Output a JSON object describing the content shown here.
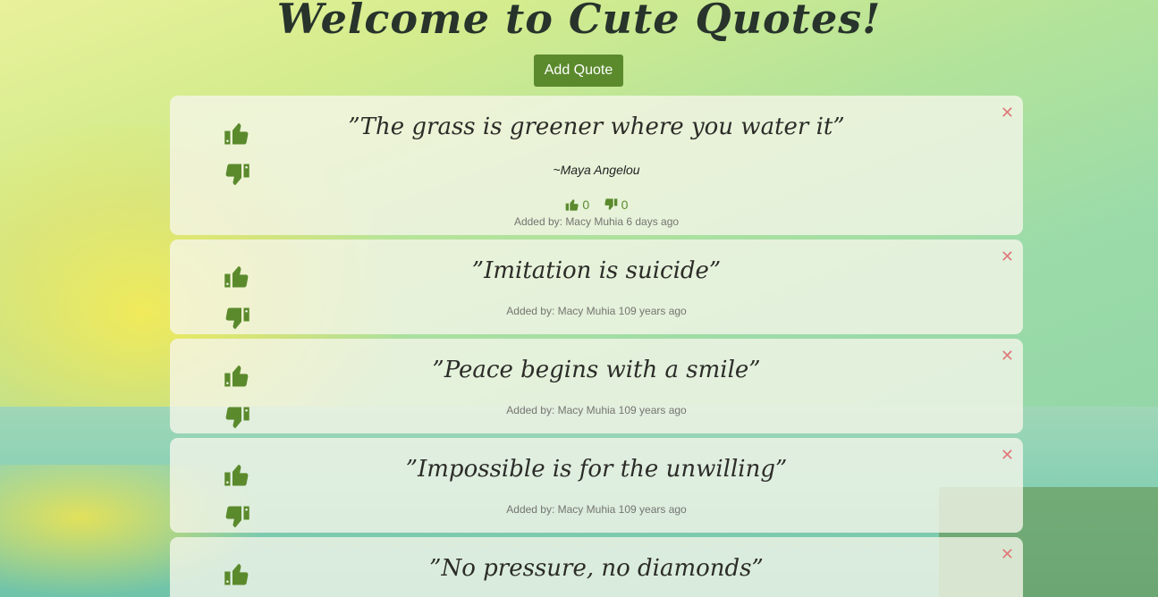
{
  "page": {
    "title": "Welcome to Cute Quotes!",
    "add_button": "Add Quote",
    "accent": "#5b8a2d"
  },
  "icons": {
    "upvote": "thumbs-up-icon",
    "downvote": "thumbs-down-icon",
    "delete": "close-icon"
  },
  "quotes": [
    {
      "text": "”The grass is greener where you water it”",
      "author": "~Maya Angelou",
      "upvotes": "0",
      "downvotes": "0",
      "added": "Added by: Macy Muhia 6 days ago"
    },
    {
      "text": "”Imitation is suicide”",
      "added": "Added by: Macy Muhia 109 years ago"
    },
    {
      "text": "”Peace begins with a smile”",
      "added": "Added by: Macy Muhia 109 years ago"
    },
    {
      "text": "”Impossible is for the unwilling”",
      "added": "Added by: Macy Muhia 109 years ago"
    },
    {
      "text": "”No pressure, no diamonds”"
    }
  ],
  "close_symbol": "✕"
}
